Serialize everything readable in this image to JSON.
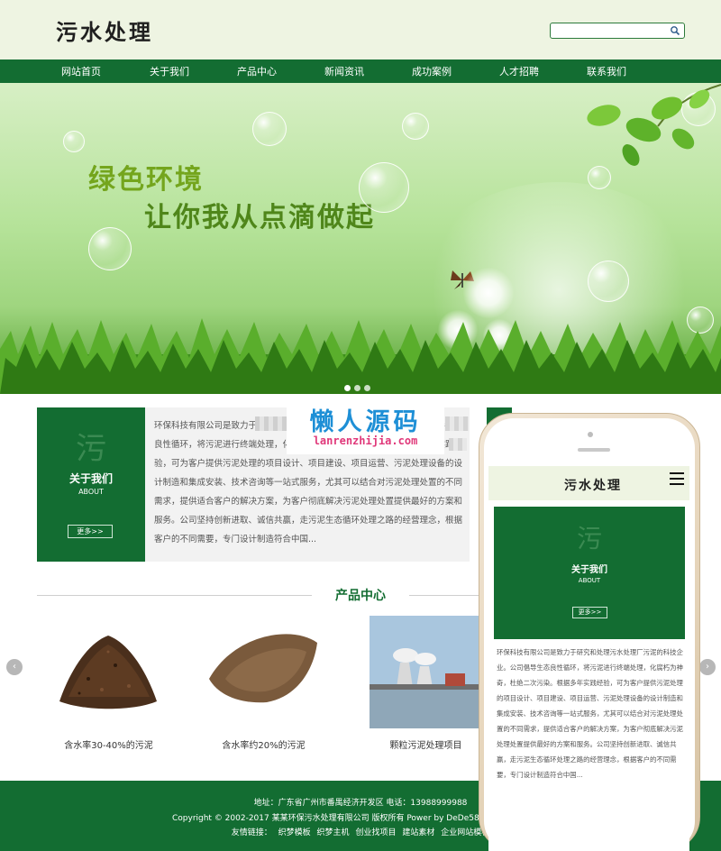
{
  "header": {
    "logo": "污水处理",
    "search": {
      "value": "",
      "placeholder": ""
    }
  },
  "nav": {
    "items": [
      "网站首页",
      "关于我们",
      "产品中心",
      "新闻资讯",
      "成功案例",
      "人才招聘",
      "联系我们"
    ]
  },
  "banner": {
    "line1": "绿色环境",
    "line2": "让你我从点滴做起",
    "slide_count": 3,
    "active_slide": 1
  },
  "about": {
    "icon_char": "污",
    "title": "关于我们",
    "subtitle": "ABOUT",
    "more": "更多>>",
    "text": "环保科技有限公司是致力于研究和处理污水处理厂污泥的科技企业。公司倡导生态良性循环，将污泥进行终端处理，化腐朽为神奇，杜绝二次污染。根据多年实践经验，可为客户提供污泥处理的项目设计、项目建设、项目运营、污泥处理设备的设计制造和集成安装、技术咨询等一站式服务，尤其可以结合对污泥处理处置的不同需求，提供适合客户的解决方案，为客户彻底解决污泥处理处置提供最好的方案和服务。公司坚持创新进取、诚信共赢，走污泥生态循环处理之路的经营理念，根据客户的不同需要，专门设计制造符合中国..."
  },
  "watermark": {
    "title": "懒人源码",
    "url": "lanrenzhijia.com"
  },
  "products": {
    "heading": "产品中心",
    "items": [
      {
        "label": "含水率30-40%的污泥"
      },
      {
        "label": "含水率约20%的污泥"
      },
      {
        "label": "颗粒污泥处理项目"
      }
    ],
    "prev": "‹",
    "next": "›"
  },
  "footer": {
    "address": "地址：广东省广州市番禺经济开发区  电话：13988999988",
    "copyright": "Copyright © 2002-2017 某某环保污水处理有限公司 版权所有 Power by DeDe58  技术支持：织梦58",
    "links_label": "友情链接：",
    "links": [
      "织梦模板",
      "织梦主机",
      "创业找项目",
      "建站素材",
      "企业网站模板"
    ]
  },
  "mobile": {
    "logo": "污水处理",
    "about_icon_char": "污",
    "about_title": "关于我们",
    "about_subtitle": "ABOUT",
    "more": "更多>>",
    "text": "环保科技有限公司是致力于研究和处理污水处理厂污泥的科技企业。公司倡导生态良性循环，将污泥进行终端处理，化腐朽为神奇，杜绝二次污染。根据多年实践经验，可为客户提供污泥处理的项目设计、项目建设、项目运营、污泥处理设备的设计制造和集成安装、技术咨询等一站式服务，尤其可以结合对污泥处理处置的不同需求，提供适合客户的解决方案，为客户彻底解决污泥处理处置提供最好的方案和服务。公司坚持创新进取、诚信共赢，走污泥生态循环处理之路的经营理念，根据客户的不同需要，专门设计制造符合中国..."
  },
  "colors": {
    "brand_green": "#136d32",
    "header_bg": "#eef4e2",
    "slogan_green": "#74a51d",
    "watermark_blue": "#1e8fd6",
    "watermark_pink": "#e0387a"
  }
}
